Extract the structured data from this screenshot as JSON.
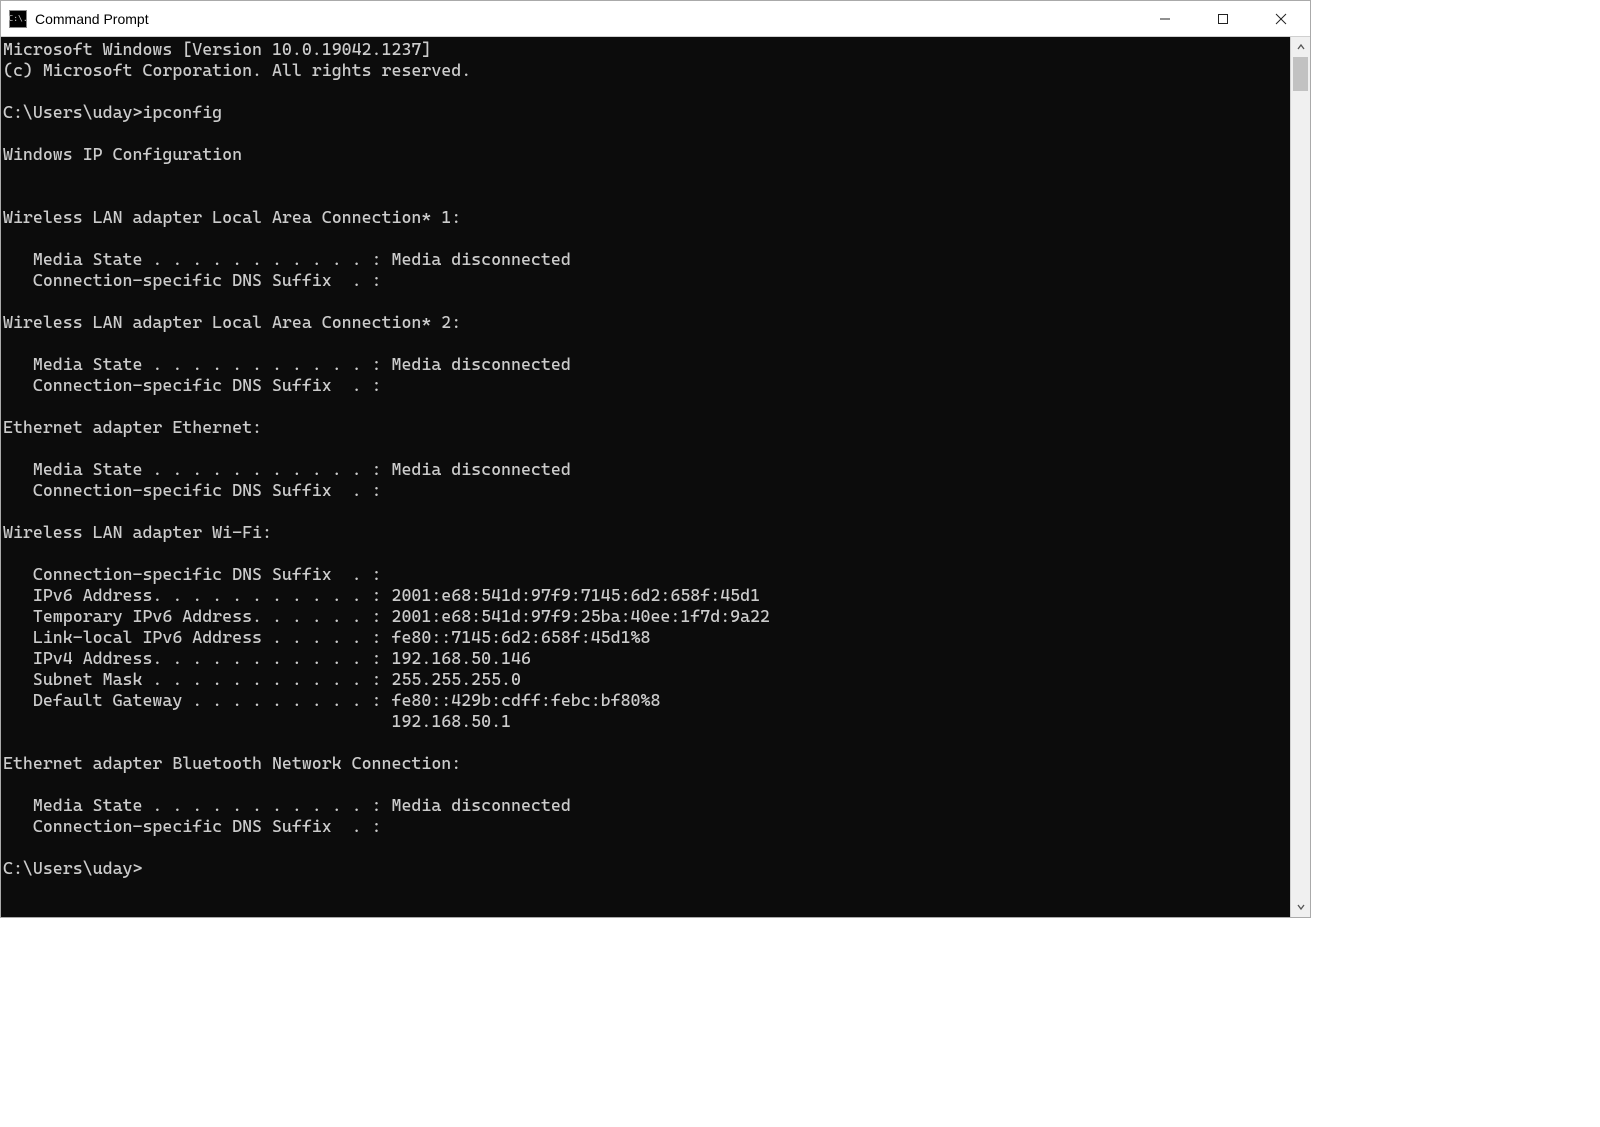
{
  "window": {
    "title": "Command Prompt",
    "icon_text": "C:\\."
  },
  "terminal": {
    "header1": "Microsoft Windows [Version 10.0.19042.1237]",
    "header2": "(c) Microsoft Corporation. All rights reserved.",
    "prompt1": "C:\\Users\\uday>ipconfig",
    "config_title": "Windows IP Configuration",
    "adapters": [
      {
        "name": "Wireless LAN adapter Local Area Connection* 1:",
        "lines": [
          "   Media State . . . . . . . . . . . : Media disconnected",
          "   Connection-specific DNS Suffix  . :"
        ]
      },
      {
        "name": "Wireless LAN adapter Local Area Connection* 2:",
        "lines": [
          "   Media State . . . . . . . . . . . : Media disconnected",
          "   Connection-specific DNS Suffix  . :"
        ]
      },
      {
        "name": "Ethernet adapter Ethernet:",
        "lines": [
          "   Media State . . . . . . . . . . . : Media disconnected",
          "   Connection-specific DNS Suffix  . :"
        ]
      },
      {
        "name": "Wireless LAN adapter Wi-Fi:",
        "lines": [
          "   Connection-specific DNS Suffix  . :",
          "   IPv6 Address. . . . . . . . . . . : 2001:e68:541d:97f9:7145:6d2:658f:45d1",
          "   Temporary IPv6 Address. . . . . . : 2001:e68:541d:97f9:25ba:40ee:1f7d:9a22",
          "   Link-local IPv6 Address . . . . . : fe80::7145:6d2:658f:45d1%8",
          "   IPv4 Address. . . . . . . . . . . : 192.168.50.146",
          "   Subnet Mask . . . . . . . . . . . : 255.255.255.0",
          "   Default Gateway . . . . . . . . . : fe80::429b:cdff:febc:bf80%8",
          "                                       192.168.50.1"
        ]
      },
      {
        "name": "Ethernet adapter Bluetooth Network Connection:",
        "lines": [
          "   Media State . . . . . . . . . . . : Media disconnected",
          "   Connection-specific DNS Suffix  . :"
        ]
      }
    ],
    "prompt2": "C:\\Users\\uday>"
  }
}
